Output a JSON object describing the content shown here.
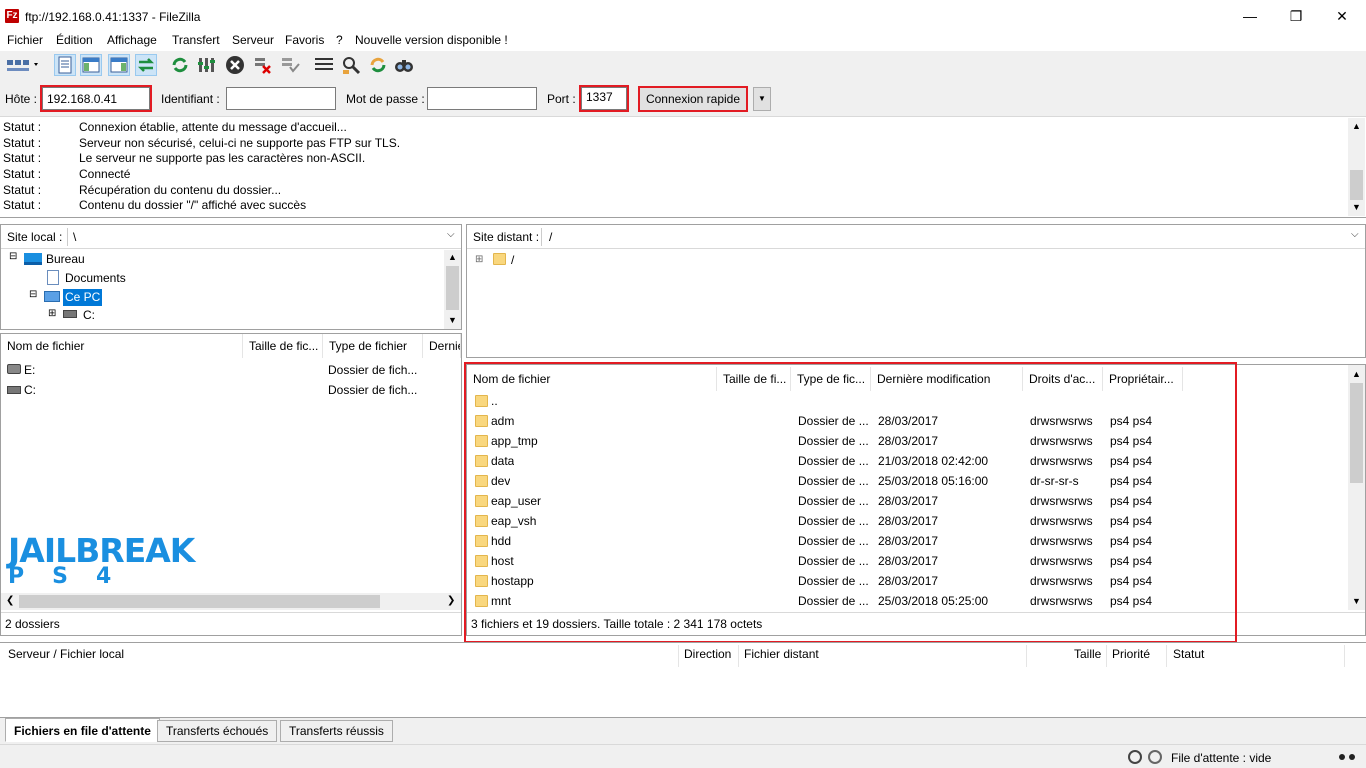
{
  "window": {
    "title": "ftp://192.168.0.41:1337 - FileZilla",
    "app_icon_letter": "Fz",
    "minimize": "—",
    "restore": "❐",
    "close": "✕"
  },
  "menu": [
    "Fichier",
    "Édition",
    "Affichage",
    "Transfert",
    "Serveur",
    "Favoris",
    "?",
    "Nouvelle version disponible !"
  ],
  "quickconnect": {
    "host_label": "Hôte :",
    "host_value": "192.168.0.41",
    "user_label": "Identifiant :",
    "user_value": "",
    "pass_label": "Mot de passe :",
    "pass_value": "",
    "port_label": "Port :",
    "port_value": "1337",
    "connect_label": "Connexion rapide"
  },
  "log": [
    {
      "label": "Statut :",
      "msg": "Connexion établie, attente du message d'accueil..."
    },
    {
      "label": "Statut :",
      "msg": "Serveur non sécurisé, celui-ci ne supporte pas FTP sur TLS."
    },
    {
      "label": "Statut :",
      "msg": "Le serveur ne supporte pas les caractères non-ASCII."
    },
    {
      "label": "Statut :",
      "msg": "Connecté"
    },
    {
      "label": "Statut :",
      "msg": "Récupération du contenu du dossier..."
    },
    {
      "label": "Statut :",
      "msg": "Contenu du dossier \"/\" affiché avec succès"
    }
  ],
  "local": {
    "site_label": "Site local :",
    "site_path": "\\",
    "tree": [
      {
        "label": "Bureau",
        "expander": "⊟"
      },
      {
        "label": "Documents",
        "expander": ""
      },
      {
        "label": "Ce PC",
        "expander": "⊟"
      },
      {
        "label": "C:",
        "expander": "⊞"
      }
    ],
    "columns": [
      "Nom de fichier",
      "Taille de fic...",
      "Type de fichier",
      "Dernié"
    ],
    "files": [
      {
        "name": "E:",
        "size": "",
        "type": "Dossier de fich..."
      },
      {
        "name": "C:",
        "size": "",
        "type": "Dossier de fich..."
      }
    ],
    "status": "2 dossiers",
    "logo_text": "JAILBREAK",
    "logo_sub": "PS4"
  },
  "remote": {
    "site_label": "Site distant :",
    "site_path": "/",
    "tree_root": "/",
    "tree_expander": "⊞",
    "columns": [
      "Nom de fichier",
      "Taille de fi...",
      "Type de fic...",
      "Dernière modification",
      "Droits d'ac...",
      "Propriétair..."
    ],
    "files": [
      {
        "name": "..",
        "size": "",
        "type": "",
        "modified": "",
        "perms": "",
        "owner": ""
      },
      {
        "name": "adm",
        "size": "",
        "type": "Dossier de ...",
        "modified": "28/03/2017",
        "perms": "drwsrwsrws",
        "owner": "ps4 ps4"
      },
      {
        "name": "app_tmp",
        "size": "",
        "type": "Dossier de ...",
        "modified": "28/03/2017",
        "perms": "drwsrwsrws",
        "owner": "ps4 ps4"
      },
      {
        "name": "data",
        "size": "",
        "type": "Dossier de ...",
        "modified": "21/03/2018 02:42:00",
        "perms": "drwsrwsrws",
        "owner": "ps4 ps4"
      },
      {
        "name": "dev",
        "size": "",
        "type": "Dossier de ...",
        "modified": "25/03/2018 05:16:00",
        "perms": "dr-sr-sr-s",
        "owner": "ps4 ps4"
      },
      {
        "name": "eap_user",
        "size": "",
        "type": "Dossier de ...",
        "modified": "28/03/2017",
        "perms": "drwsrwsrws",
        "owner": "ps4 ps4"
      },
      {
        "name": "eap_vsh",
        "size": "",
        "type": "Dossier de ...",
        "modified": "28/03/2017",
        "perms": "drwsrwsrws",
        "owner": "ps4 ps4"
      },
      {
        "name": "hdd",
        "size": "",
        "type": "Dossier de ...",
        "modified": "28/03/2017",
        "perms": "drwsrwsrws",
        "owner": "ps4 ps4"
      },
      {
        "name": "host",
        "size": "",
        "type": "Dossier de ...",
        "modified": "28/03/2017",
        "perms": "drwsrwsrws",
        "owner": "ps4 ps4"
      },
      {
        "name": "hostapp",
        "size": "",
        "type": "Dossier de ...",
        "modified": "28/03/2017",
        "perms": "drwsrwsrws",
        "owner": "ps4 ps4"
      },
      {
        "name": "mnt",
        "size": "",
        "type": "Dossier de ...",
        "modified": "25/03/2018 05:25:00",
        "perms": "drwsrwsrws",
        "owner": "ps4 ps4"
      }
    ],
    "status": "3 fichiers et 19 dossiers. Taille totale : 2 341 178 octets"
  },
  "queue": {
    "columns": [
      "Serveur / Fichier local",
      "Direction",
      "Fichier distant",
      "Taille",
      "Priorité",
      "Statut"
    ],
    "tabs": [
      "Fichiers en file d'attente",
      "Transferts échoués",
      "Transferts réussis"
    ]
  },
  "statusbar": {
    "queue_text": "File d'attente : vide"
  },
  "colors": {
    "highlight_red": "#e21b23",
    "selection_blue": "#0078d7",
    "folder_yellow": "#f9d77e"
  }
}
